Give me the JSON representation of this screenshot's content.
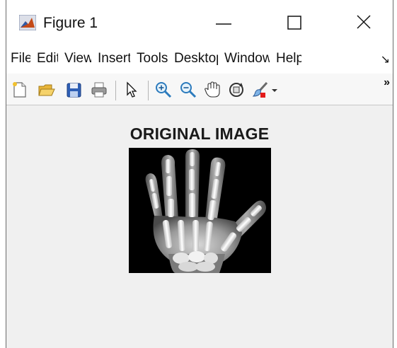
{
  "window": {
    "title": "Figure 1"
  },
  "menu": {
    "items": [
      "File",
      "Edit",
      "View",
      "Insert",
      "Tools",
      "Desktop",
      "Window",
      "Help"
    ],
    "overflow": "↘"
  },
  "toolbar": {
    "icons": [
      "new-figure-icon",
      "open-file-icon",
      "save-icon",
      "print-icon",
      "edit-plot-arrow-icon",
      "zoom-in-icon",
      "zoom-out-icon",
      "pan-hand-icon",
      "rotate-3d-icon",
      "data-brush-icon"
    ],
    "overflow": "»"
  },
  "axes": {
    "title": "ORIGINAL IMAGE"
  },
  "colors": {
    "background": "#f0f0f0",
    "titlebar": "#ffffff",
    "image_background": "#000000"
  }
}
